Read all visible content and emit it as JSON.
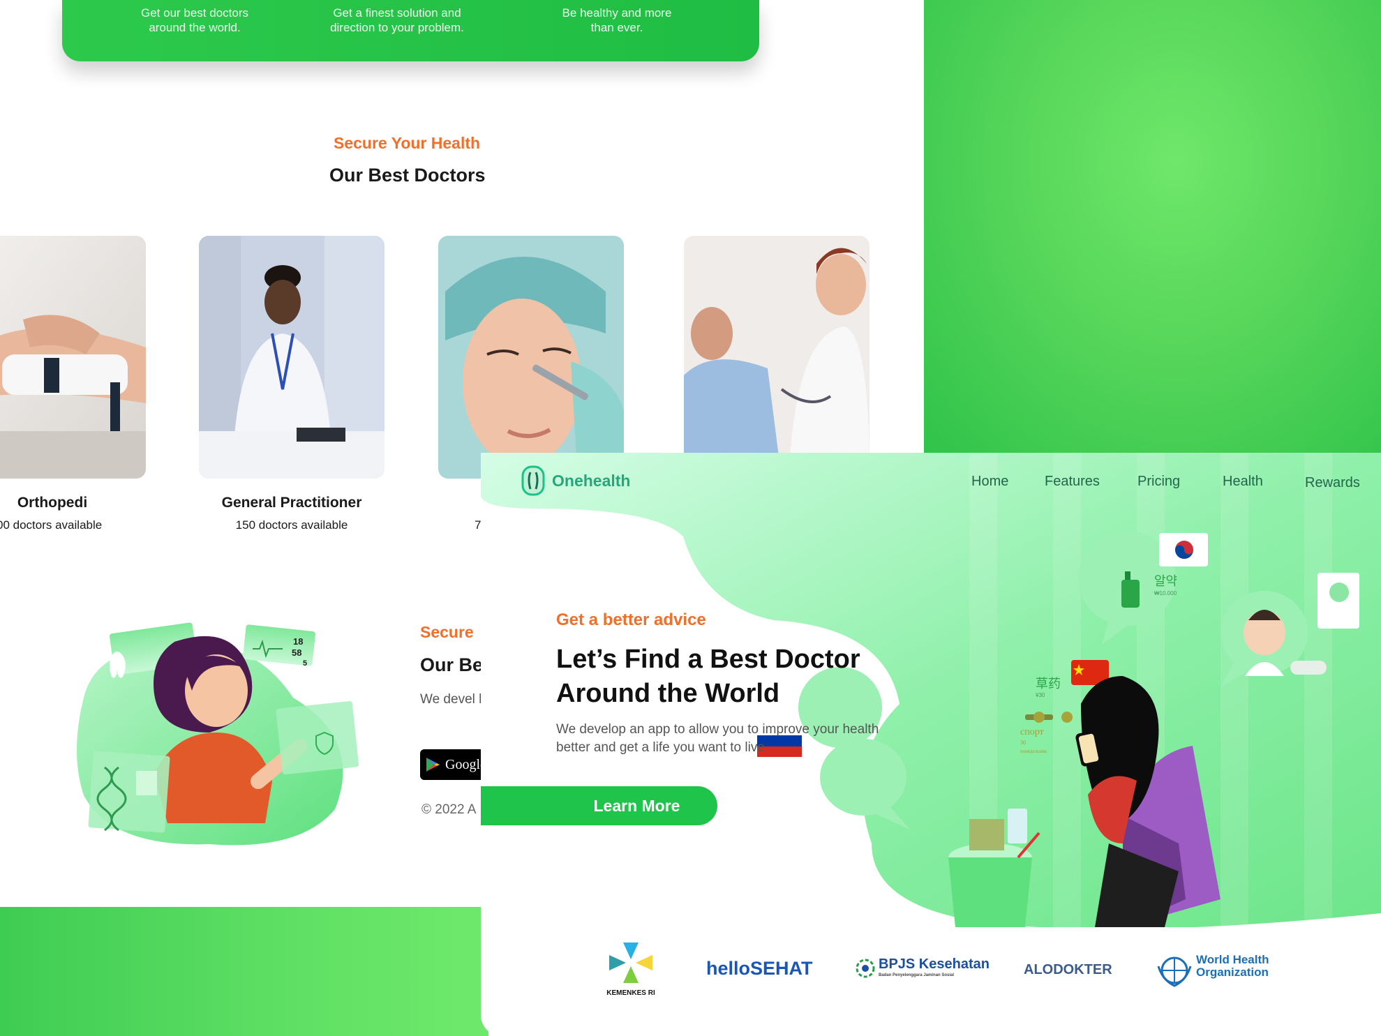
{
  "features": [
    {
      "text": "Get our best doctors around the world."
    },
    {
      "text": "Get a finest solution and direction to your problem."
    },
    {
      "text": "Be healthy and more than ever."
    }
  ],
  "doctors_section": {
    "kicker": "Secure Your Health",
    "title": "Our Best Doctors",
    "cards": [
      {
        "name": "Orthopedi",
        "count": "00 doctors available"
      },
      {
        "name": "General Practitioner",
        "count": "150 doctors available"
      },
      {
        "name": "",
        "count": "7"
      },
      {
        "name": "",
        "count": ""
      }
    ]
  },
  "app_section": {
    "kicker": "Secure",
    "title": "Our Be",
    "description": "We devel health be",
    "store_badge": "Google",
    "copyright": "© 2022 A"
  },
  "hero": {
    "brand": "Onehealth",
    "nav": [
      "Home",
      "Features",
      "Pricing",
      "Health",
      "Rewards"
    ],
    "kicker": "Get a better advice",
    "title": "Let’s Find a Best Doctor Around the World",
    "description": "We develop an app to allow you to improve your health better and get a life you want to live",
    "cta": "Learn More",
    "bubbles": {
      "korean": "알약",
      "korean_price": "₩10.000",
      "chinese": "草药",
      "chinese_price": "¥30",
      "russian": "спорт",
      "russian_sub": "30",
      "russian_sub2": "понедельник"
    },
    "illus_left": {
      "hr1": "18",
      "hr2": "58",
      "hr3": "5"
    }
  },
  "partners": [
    {
      "name": "KEMENKES RI"
    },
    {
      "name": "helloSEHAT"
    },
    {
      "name": "BPJS Kesehatan",
      "sub": "Badan Penyelenggara Jaminan Sosial"
    },
    {
      "name": "ALODOKTER"
    },
    {
      "name": "World Health Organization",
      "line1": "World Health",
      "line2": "Organization"
    }
  ],
  "colors": {
    "brand_green": "#1fc54a",
    "accent_orange": "#f26f2a",
    "brand_teal": "#26a77b"
  }
}
